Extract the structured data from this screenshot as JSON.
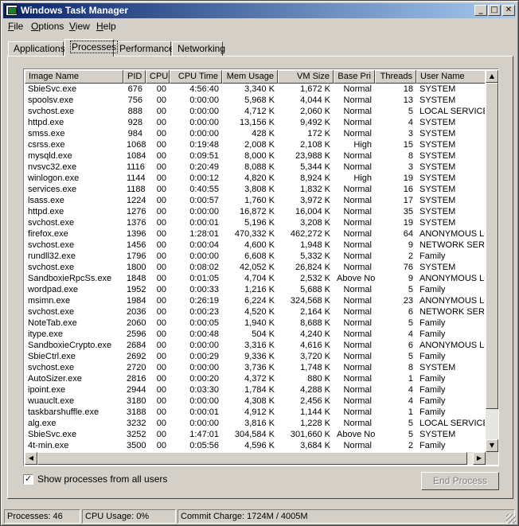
{
  "window": {
    "title": "Windows Task Manager",
    "controls": {
      "minimize": "_",
      "maximize": "□",
      "close": "✕"
    }
  },
  "menu": [
    {
      "label": "File",
      "ul": "F",
      "rest": "ile"
    },
    {
      "label": "Options",
      "ul": "O",
      "rest": "ptions"
    },
    {
      "label": "View",
      "ul": "V",
      "rest": "iew"
    },
    {
      "label": "Help",
      "ul": "H",
      "rest": "elp"
    }
  ],
  "tabs": [
    {
      "label": "Applications",
      "active": false
    },
    {
      "label": "Processes",
      "active": true
    },
    {
      "label": "Performance",
      "active": false
    },
    {
      "label": "Networking",
      "active": false
    }
  ],
  "table": {
    "columns": [
      "Image Name",
      "PID",
      "CPU",
      "CPU Time",
      "Mem Usage",
      "VM Size",
      "Base Pri",
      "Threads",
      "User Name"
    ],
    "rows": [
      [
        "SbieSvc.exe",
        "676",
        "00",
        "4:56:40",
        "3,340 K",
        "1,672 K",
        "Normal",
        "18",
        "SYSTEM"
      ],
      [
        "spoolsv.exe",
        "756",
        "00",
        "0:00:00",
        "5,968 K",
        "4,044 K",
        "Normal",
        "13",
        "SYSTEM"
      ],
      [
        "svchost.exe",
        "888",
        "00",
        "0:00:00",
        "4,712 K",
        "2,060 K",
        "Normal",
        "5",
        "LOCAL SERVICE"
      ],
      [
        "httpd.exe",
        "928",
        "00",
        "0:00:00",
        "13,156 K",
        "9,492 K",
        "Normal",
        "4",
        "SYSTEM"
      ],
      [
        "smss.exe",
        "984",
        "00",
        "0:00:00",
        "428 K",
        "172 K",
        "Normal",
        "3",
        "SYSTEM"
      ],
      [
        "csrss.exe",
        "1068",
        "00",
        "0:19:48",
        "2,008 K",
        "2,108 K",
        "High",
        "15",
        "SYSTEM"
      ],
      [
        "mysqld.exe",
        "1084",
        "00",
        "0:09:51",
        "8,000 K",
        "23,988 K",
        "Normal",
        "8",
        "SYSTEM"
      ],
      [
        "nvsvc32.exe",
        "1116",
        "00",
        "0:20:49",
        "8,088 K",
        "5,344 K",
        "Normal",
        "3",
        "SYSTEM"
      ],
      [
        "winlogon.exe",
        "1144",
        "00",
        "0:00:12",
        "4,820 K",
        "8,924 K",
        "High",
        "19",
        "SYSTEM"
      ],
      [
        "services.exe",
        "1188",
        "00",
        "0:40:55",
        "3,808 K",
        "1,832 K",
        "Normal",
        "16",
        "SYSTEM"
      ],
      [
        "lsass.exe",
        "1224",
        "00",
        "0:00:57",
        "1,760 K",
        "3,972 K",
        "Normal",
        "17",
        "SYSTEM"
      ],
      [
        "httpd.exe",
        "1276",
        "00",
        "0:00:00",
        "16,872 K",
        "16,004 K",
        "Normal",
        "35",
        "SYSTEM"
      ],
      [
        "svchost.exe",
        "1376",
        "00",
        "0:00:01",
        "5,196 K",
        "3,208 K",
        "Normal",
        "19",
        "SYSTEM"
      ],
      [
        "firefox.exe",
        "1396",
        "00",
        "1:28:01",
        "470,332 K",
        "462,272 K",
        "Normal",
        "64",
        "ANONYMOUS LOGON"
      ],
      [
        "svchost.exe",
        "1456",
        "00",
        "0:00:04",
        "4,600 K",
        "1,948 K",
        "Normal",
        "9",
        "NETWORK SERVICE"
      ],
      [
        "rundll32.exe",
        "1796",
        "00",
        "0:00:00",
        "6,608 K",
        "5,332 K",
        "Normal",
        "2",
        "Family"
      ],
      [
        "svchost.exe",
        "1800",
        "00",
        "0:08:02",
        "42,052 K",
        "26,824 K",
        "Normal",
        "76",
        "SYSTEM"
      ],
      [
        "SandboxieRpcSs.exe",
        "1848",
        "00",
        "0:01:05",
        "4,704 K",
        "2,532 K",
        "Above Normal",
        "9",
        "ANONYMOUS LOGON"
      ],
      [
        "wordpad.exe",
        "1952",
        "00",
        "0:00:33",
        "1,216 K",
        "5,688 K",
        "Normal",
        "5",
        "Family"
      ],
      [
        "msimn.exe",
        "1984",
        "00",
        "0:26:19",
        "6,224 K",
        "324,568 K",
        "Normal",
        "23",
        "ANONYMOUS LOGON"
      ],
      [
        "svchost.exe",
        "2036",
        "00",
        "0:00:23",
        "4,520 K",
        "2,164 K",
        "Normal",
        "6",
        "NETWORK SERVICE"
      ],
      [
        "NoteTab.exe",
        "2060",
        "00",
        "0:00:05",
        "1,940 K",
        "8,688 K",
        "Normal",
        "5",
        "Family"
      ],
      [
        "itype.exe",
        "2596",
        "00",
        "0:00:48",
        "504 K",
        "4,240 K",
        "Normal",
        "4",
        "Family"
      ],
      [
        "SandboxieCrypto.exe",
        "2684",
        "00",
        "0:00:00",
        "3,316 K",
        "4,616 K",
        "Normal",
        "6",
        "ANONYMOUS LOGON"
      ],
      [
        "SbieCtrl.exe",
        "2692",
        "00",
        "0:00:29",
        "9,336 K",
        "3,720 K",
        "Normal",
        "5",
        "Family"
      ],
      [
        "svchost.exe",
        "2720",
        "00",
        "0:00:00",
        "3,736 K",
        "1,748 K",
        "Normal",
        "8",
        "SYSTEM"
      ],
      [
        "AutoSizer.exe",
        "2816",
        "00",
        "0:00:20",
        "4,372 K",
        "880 K",
        "Normal",
        "1",
        "Family"
      ],
      [
        "ipoint.exe",
        "2944",
        "00",
        "0:03:30",
        "1,784 K",
        "4,288 K",
        "Normal",
        "4",
        "Family"
      ],
      [
        "wuauclt.exe",
        "3180",
        "00",
        "0:00:00",
        "4,308 K",
        "2,456 K",
        "Normal",
        "4",
        "Family"
      ],
      [
        "taskbarshuffle.exe",
        "3188",
        "00",
        "0:00:01",
        "4,912 K",
        "1,144 K",
        "Normal",
        "1",
        "Family"
      ],
      [
        "alg.exe",
        "3232",
        "00",
        "0:00:00",
        "3,816 K",
        "1,228 K",
        "Normal",
        "5",
        "LOCAL SERVICE"
      ],
      [
        "SbieSvc.exe",
        "3252",
        "00",
        "1:47:01",
        "304,584 K",
        "301,660 K",
        "Above Normal",
        "5",
        "SYSTEM"
      ],
      [
        "4t-min.exe",
        "3500",
        "00",
        "0:05:56",
        "4,596 K",
        "3,684 K",
        "Normal",
        "2",
        "Family"
      ]
    ]
  },
  "show_all": {
    "label": "Show processes from all users",
    "checked": "✓"
  },
  "end_process": "End Process",
  "status": {
    "processes": "Processes: 46",
    "cpu": "CPU Usage: 0%",
    "commit": "Commit Charge: 1724M / 4005M"
  }
}
